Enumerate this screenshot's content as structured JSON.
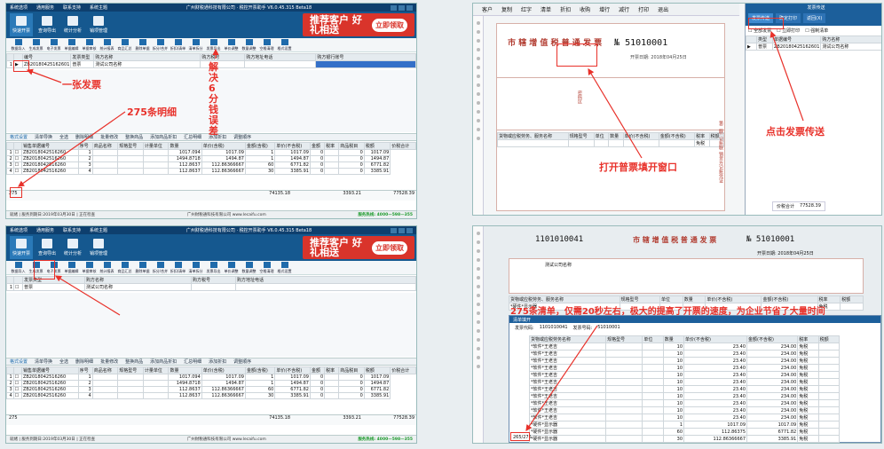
{
  "window": {
    "title": "广州财税通科技有限公司 · 税控开票助手 V6.0.45.315 Beta18",
    "menus": [
      "系统选项",
      "通用服务",
      "联系支持",
      "系统主题"
    ]
  },
  "ribbon": {
    "buttons": [
      "快速开票",
      "查询导出",
      "统计分析",
      "销项管理"
    ],
    "promo_text": "推荐客户 好礼相送",
    "promo_button": "立即领取"
  },
  "toolbar": {
    "items": [
      "数据导入",
      "生成发票",
      "电子发票",
      "单据编辑",
      "单据审核",
      "统计报表",
      "商品汇总",
      "删除单据",
      "拆分/合并",
      "折扣/清单",
      "清单拆分",
      "发票导出",
      "单价调整",
      "数量调整",
      "空格清理",
      "格式设置"
    ]
  },
  "invoice_grid": {
    "headers": [
      "",
      "",
      "编号",
      "发票类型",
      "购方名称",
      "购方税号",
      "购方地址电话",
      "购方银行账号"
    ],
    "row": [
      "1",
      "▶",
      "ZB20180425162601",
      "普票",
      "测试公司名称",
      "",
      "",
      ""
    ]
  },
  "detail_bar": {
    "items": [
      "格式设置",
      "清单导换",
      "全选",
      "删除明细",
      "批量修改",
      "整换商品",
      "添加商品折扣",
      "汇总明细",
      "添加折扣",
      "调整顺序"
    ]
  },
  "detail_grid": {
    "headers": [
      "",
      "",
      "销售单据编号",
      "序号",
      "商品名称",
      "规格型号",
      "计量单位",
      "数量",
      "单价(含税)",
      "金额(含税)",
      "单价(不含税)",
      "金额",
      "税率",
      "商品税目",
      "税额",
      "价税合计"
    ],
    "rows": [
      [
        "1",
        "☐",
        "ZB2018042516260",
        "1",
        "",
        "",
        "",
        "1017.094",
        "1017.09",
        "1",
        "1017.09",
        "0",
        "",
        "0",
        "1017.09"
      ],
      [
        "2",
        "☐",
        "ZB2018042516260",
        "2",
        "",
        "",
        "",
        "1494.8718",
        "1494.87",
        "1",
        "1494.87",
        "0",
        "",
        "0",
        "1494.87"
      ],
      [
        "3",
        "☐",
        "ZB2018042516260",
        "3",
        "",
        "",
        "",
        "112.8637",
        "112.86366667",
        "60",
        "6771.82",
        "0",
        "",
        "0",
        "6771.82"
      ],
      [
        "4",
        "☐",
        "ZB2018042516260",
        "4",
        "",
        "",
        "",
        "112.8637",
        "112.86366667",
        "30",
        "3385.91",
        "0",
        "",
        "0",
        "3385.91"
      ]
    ],
    "total_count": "275",
    "total_amount": "74135.18",
    "tax_total": "3393.21",
    "grand_total": "77528.39"
  },
  "status_bar": {
    "left": "就绪 | 服务到期日:2019年03月30日 | 正在检查",
    "center": "广州财税通科技有限公司   www.lecaifu.com",
    "hotline": "服务热线: 4000—598—355"
  },
  "annotations": {
    "a1": "一张发票",
    "a2": "275条明细",
    "a3": "解决6分钱误差",
    "a4": "点击发票传送",
    "a5": "打开普票填开窗口",
    "a6": "275条清单，仅需20秒左右，极大的提高了开票的速度，为企业节省了大量时间"
  },
  "p2_invoice_grid": {
    "headers": [
      "",
      "",
      "发票类型",
      "购方名称",
      "购方税号",
      "购方地址电话"
    ],
    "row": [
      "1",
      "☐",
      "普票",
      "测试公司名称",
      "",
      ""
    ]
  },
  "invoice_form": {
    "title": "市 辖 增 值 税 普 通 发 票",
    "no_label": "№",
    "number": "51010001",
    "date": "开票日期: 2018年04月25日",
    "side_label": "第二联: 记账联 销货方记账凭证",
    "buyer_labels": [
      "名　　称:",
      "纳税人识别号:",
      "地 址、电 话:",
      "开户行及账号:"
    ],
    "pwd_label": "密码区",
    "item_headers": [
      "货物或应税劳务、服务名称",
      "规格型号",
      "单位",
      "数量",
      "单价(不含税)",
      "金额(不含税)",
      "税率",
      "税额"
    ],
    "tax_free": "免税",
    "toolbar": [
      "客户",
      "复制",
      "红字",
      "清单",
      "折扣",
      "收购",
      "增行",
      "减行",
      "打印",
      "退出"
    ]
  },
  "send_panel": {
    "title": "发票传送",
    "buttons": [
      "发票传送",
      "确定打印",
      "返回(X)"
    ],
    "options": [
      "全部发票",
      "立即打印",
      "强制清单"
    ],
    "headers": [
      "类型",
      "单据编号",
      "购方名称"
    ],
    "row": [
      "普票",
      "ZB20180425162601",
      "测试公司名称"
    ],
    "total_label": "价税合计",
    "total_value": "77528.39"
  },
  "invoice_form2": {
    "code": "1101010041",
    "title": "市 辖 增 值 税 普 通 发 票",
    "no_label": "№",
    "number": "51010001",
    "date": "开票日期: 2018年04月25日",
    "buyer_name": "测试公司名称",
    "item_headers": [
      "货物或应税劳务、服务名称",
      "规格型号",
      "单位",
      "数量",
      "单价(不含税)",
      "金额(不含税)",
      "税率",
      "税额"
    ],
    "item_row": [
      "*硬件*显示器",
      "",
      "",
      "",
      "",
      "",
      "免税",
      ""
    ]
  },
  "list_dialog": {
    "title": "清单填开",
    "code_label": "发票代码:",
    "code": "1101010041",
    "no_label": "发票号码:",
    "no": "51010001",
    "headers": [
      "货物或应税劳务名称",
      "规格型号",
      "单位",
      "数量",
      "单价(不含税)",
      "金额(不含税)",
      "税率",
      "税额"
    ],
    "rows": [
      [
        "*软件*王老吉",
        "",
        "",
        "10",
        "23.40",
        "234.00",
        "免税",
        ""
      ],
      [
        "*软件*王老吉",
        "",
        "",
        "10",
        "23.40",
        "234.00",
        "免税",
        ""
      ],
      [
        "*软件*王老吉",
        "",
        "",
        "10",
        "23.40",
        "234.00",
        "免税",
        ""
      ],
      [
        "*软件*王老吉",
        "",
        "",
        "10",
        "23.40",
        "234.00",
        "免税",
        ""
      ],
      [
        "*软件*王老吉",
        "",
        "",
        "10",
        "23.40",
        "234.00",
        "免税",
        ""
      ],
      [
        "*软件*王老吉",
        "",
        "",
        "10",
        "23.40",
        "234.00",
        "免税",
        ""
      ],
      [
        "*软件*王老吉",
        "",
        "",
        "10",
        "23.40",
        "234.00",
        "免税",
        ""
      ],
      [
        "*软件*王老吉",
        "",
        "",
        "10",
        "23.40",
        "234.00",
        "免税",
        ""
      ],
      [
        "*软件*王老吉",
        "",
        "",
        "10",
        "23.40",
        "234.00",
        "免税",
        ""
      ],
      [
        "*软件*王老吉",
        "",
        "",
        "10",
        "23.40",
        "234.00",
        "免税",
        ""
      ],
      [
        "*软件*王老吉",
        "",
        "",
        "10",
        "23.40",
        "234.00",
        "免税",
        ""
      ],
      [
        "*硬件*显示器",
        "",
        "",
        "1",
        "1017.09",
        "1017.09",
        "免税",
        ""
      ],
      [
        "*硬件*显示器",
        "",
        "",
        "60",
        "112.86375",
        "6771.82",
        "免税",
        ""
      ],
      [
        "*硬件*显示器",
        "",
        "",
        "30",
        "112.86366667",
        "3385.91",
        "免税",
        ""
      ],
      [
        "*硬件*显示器",
        "",
        "",
        "100",
        "33.76651111",
        "6076.36",
        "免税",
        ""
      ]
    ],
    "count": "265/275"
  }
}
